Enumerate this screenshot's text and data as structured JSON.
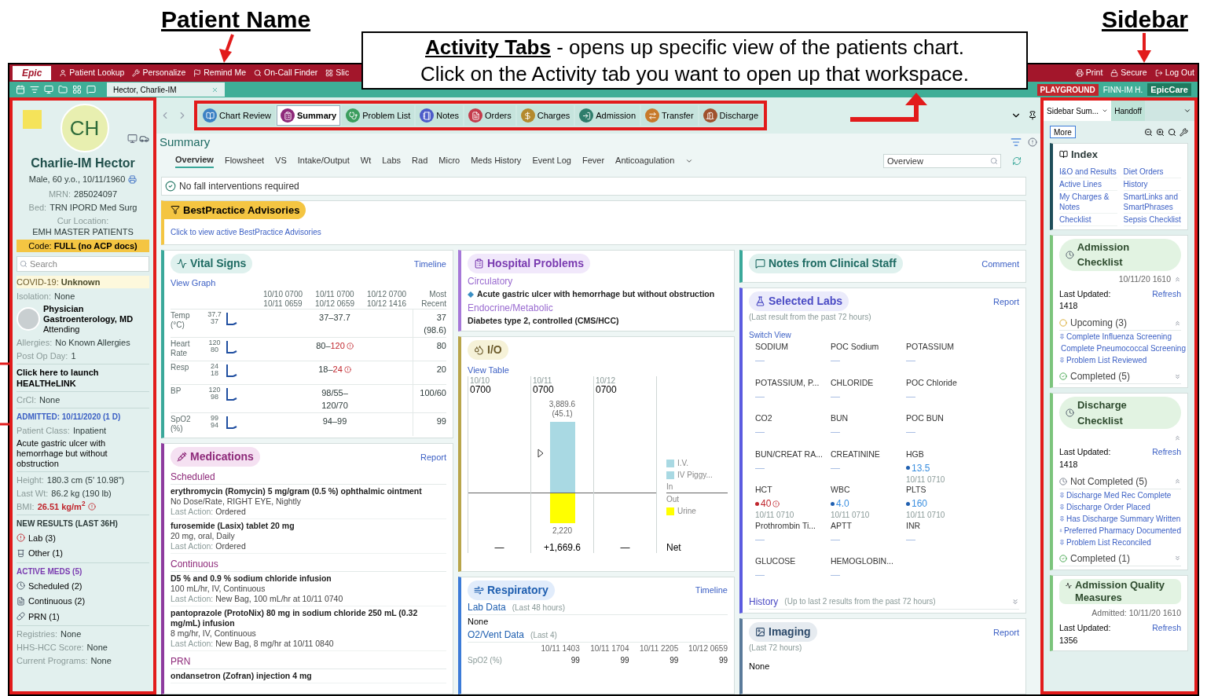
{
  "annotations": {
    "patient_name": "Patient Name",
    "sidebar": "Sidebar",
    "callout_title": "Activity Tabs",
    "callout_rest": " - opens up specific view of the patients chart.",
    "callout_line2": "Click on the Activity tab you want to open up that workspace."
  },
  "top_menu": {
    "logo": "Epic",
    "items": [
      "Patient Lookup",
      "Personalize",
      "Remind Me",
      "On-Call Finder",
      "Slic"
    ],
    "right_items": [
      "Print",
      "Secure",
      "Log Out"
    ]
  },
  "workspace_tab": "Hector, Charlie-IM",
  "environment": {
    "badge": "PLAYGROUND",
    "user": "FINN-IM H.",
    "app": "EpicCare"
  },
  "activity_tabs": [
    {
      "label": "Chart Review",
      "selected": false
    },
    {
      "label": "Summary",
      "selected": true
    },
    {
      "label": "Problem List",
      "selected": false
    },
    {
      "label": "Notes",
      "selected": false
    },
    {
      "label": "Orders",
      "selected": false
    },
    {
      "label": "Charges",
      "selected": false
    },
    {
      "label": "Admission",
      "selected": false
    },
    {
      "label": "Transfer",
      "selected": false
    },
    {
      "label": "Discharge",
      "selected": false
    }
  ],
  "patient": {
    "initials": "CH",
    "name": "Charlie-IM Hector",
    "demographics": "Male, 60 y.o., 10/11/1960",
    "details": [
      {
        "label": "MRN:",
        "value": "285024097"
      },
      {
        "label": "Bed:",
        "value": "TRN IPORD Med Surg"
      },
      {
        "label": "Cur Location:",
        "value": "EMH MASTER PATIENTS"
      }
    ],
    "code_label": "Code:",
    "code_value": "FULL (no ACP docs)",
    "search_placeholder": "Search",
    "covid_label": "COVID-19:",
    "covid_value": "Unknown",
    "isolation": {
      "label": "Isolation:",
      "value": "None"
    },
    "physician": {
      "role": "Physician",
      "specialty": "Gastroenterology, MD",
      "relation": "Attending"
    },
    "after_physician": [
      {
        "label": "Allergies:",
        "value": "No Known Allergies"
      },
      {
        "label": "Post Op Day:",
        "value": "1"
      }
    ],
    "healthelink": "Click here to launch HEALTHeLINK",
    "crcl": {
      "label": "CrCl:",
      "value": "None"
    },
    "admitted": "ADMITTED: 10/11/2020 (1 D)",
    "patient_class": {
      "label": "Patient Class:",
      "value": "Inpatient"
    },
    "diagnosis": "Acute gastric ulcer with hemorrhage but without obstruction",
    "measures": [
      {
        "label": "Height:",
        "value": "180.3 cm (5' 10.98\")",
        "flagged": false
      },
      {
        "label": "Last Wt:",
        "value": "86.2 kg (190 lb)",
        "flagged": false
      },
      {
        "label": "BMI:",
        "value": "26.51 kg/m$^{2}$",
        "flagged": true
      }
    ],
    "new_results": {
      "heading": "NEW RESULTS (LAST 36H)",
      "items": [
        "Lab (3)",
        "Other (1)"
      ]
    },
    "active_meds": {
      "heading": "ACTIVE MEDS (5)",
      "items": [
        "Scheduled (2)",
        "Continuous (2)",
        "PRN (1)"
      ]
    },
    "footer": [
      {
        "label": "Registries:",
        "value": "None"
      },
      {
        "label": "HHS-HCC Score:",
        "value": "None"
      },
      {
        "label": "Current Programs:",
        "value": "None"
      }
    ]
  },
  "summary": {
    "title": "Summary",
    "subtabs": [
      {
        "label": "Overview",
        "selected": true
      },
      {
        "label": "Flowsheet",
        "selected": false
      },
      {
        "label": "VS",
        "selected": false
      },
      {
        "label": "Intake/Output",
        "selected": false
      },
      {
        "label": "Wt",
        "selected": false
      },
      {
        "label": "Labs",
        "selected": false
      },
      {
        "label": "Rad",
        "selected": false
      },
      {
        "label": "Micro",
        "selected": false
      },
      {
        "label": "Meds History",
        "selected": false
      },
      {
        "label": "Event Log",
        "selected": false
      },
      {
        "label": "Fever",
        "selected": false
      },
      {
        "label": "Anticoagulation",
        "selected": false
      }
    ],
    "search_value": "Overview",
    "banner": "No fall interventions required",
    "bpa": {
      "title": "BestPractice Advisories",
      "link": "Click to view active BestPractice Advisories"
    },
    "vitals": {
      "title": "Vital Signs",
      "action": "Timeline",
      "link": "View Graph",
      "columns": [
        {
          "line1": "10/10 0700",
          "line2": "10/11 0659"
        },
        {
          "line1": "10/11 0700",
          "line2": "10/12 0659"
        },
        {
          "line1": "10/12 0700",
          "line2": "10/12 1416"
        },
        {
          "line1": "Most",
          "line2": "Recent"
        }
      ],
      "rows": [
        {
          "name": "Temp (°C)",
          "high": "37.7",
          "low": "37",
          "range": "37–37.7",
          "recent": "37 (98.6)"
        },
        {
          "name": "Heart Rate",
          "high": "120",
          "low": "80",
          "range": "80–",
          "flagged": "120",
          "recent": "80"
        },
        {
          "name": "Resp",
          "high": "24",
          "low": "18",
          "range": "18–",
          "flagged": "24",
          "recent": "20"
        },
        {
          "name": "BP",
          "high": "120",
          "low": "98",
          "range": "98/55–120/70",
          "recent": "100/60"
        },
        {
          "name": "SpO2 (%)",
          "high": "99",
          "low": "94",
          "range": "94–99",
          "recent": "99"
        }
      ]
    },
    "medications": {
      "title": "Medications",
      "action": "Report",
      "groups": [
        {
          "heading": "Scheduled",
          "items": [
            {
              "name": "erythromycin (Romycin) 5 mg/gram (0.5 %) ophthalmic ointment",
              "sig": "No Dose/Rate, RIGHT EYE, Nightly",
              "action_label": "Last Action:",
              "action": "Ordered"
            },
            {
              "name": "furosemide (Lasix) tablet 20 mg",
              "sig": "20 mg, oral, Daily",
              "action_label": "Last Action:",
              "action": "Ordered"
            }
          ]
        },
        {
          "heading": "Continuous",
          "items": [
            {
              "name": "D5 % and 0.9 % sodium chloride infusion",
              "sig": "100 mL/hr, IV, Continuous",
              "action_label": "Last Action:",
              "action": "New Bag, 100 mL/hr at 10/11 0740"
            },
            {
              "name": "pantoprazole (ProtoNix) 80 mg in sodium chloride 250 mL (0.32 mg/mL) infusion",
              "sig": "8 mg/hr, IV, Continuous",
              "action_label": "Last Action:",
              "action": "New Bag, 8 mg/hr at 10/11 0840"
            }
          ]
        },
        {
          "heading": "PRN",
          "items": [
            {
              "name": "ondansetron (Zofran) injection 4 mg"
            }
          ]
        }
      ]
    },
    "problems": {
      "title": "Hospital Problems",
      "groups": [
        {
          "category": "Circulatory",
          "items": [
            {
              "text": "Acute gastric ulcer with hemorrhage but without obstruction",
              "principal": true
            }
          ]
        },
        {
          "category": "Endocrine/Metabolic",
          "items": [
            {
              "text": "Diabetes type 2, controlled (CMS/HCC)",
              "principal": false
            }
          ]
        }
      ]
    },
    "io": {
      "title": "I/O",
      "link": "View Table",
      "dates": [
        {
          "date": "10/10",
          "time": "0700"
        },
        {
          "date": "10/11",
          "time": "0700"
        },
        {
          "date": "10/12",
          "time": "0700"
        }
      ],
      "in_total": "3,889.6",
      "in_sub": "(45.1)",
      "out_total": "2,220",
      "nets": [
        "—",
        "+1,669.6",
        "—"
      ],
      "net_label": "Net",
      "in_items": [
        {
          "label": "I.V.",
          "color": "#a9d9e3"
        },
        {
          "label": "IV Piggy...",
          "color": "#a9d9e3"
        }
      ],
      "in_label": "In",
      "out_label": "Out",
      "out_items": [
        {
          "label": "Urine",
          "color": "#ffff00"
        }
      ]
    },
    "respiratory": {
      "title": "Respiratory",
      "action": "Timeline",
      "lab_title": "Lab Data",
      "lab_note": "(Last 48 hours)",
      "lab_value": "None",
      "vent_title": "O2/Vent Data",
      "vent_note": "(Last 4)",
      "times": [
        "10/11 1403",
        "10/11 1704",
        "10/11 2205",
        "10/12 0659"
      ],
      "row_label": "SpO2 (%)",
      "values": [
        "99",
        "99",
        "99",
        "99"
      ]
    },
    "notes": {
      "title": "Notes from Clinical Staff",
      "action": "Comment"
    },
    "labs": {
      "title": "Selected Labs",
      "action": "Report",
      "subtitle": "(Last result from the past 72 hours)",
      "link": "Switch View",
      "items": [
        {
          "name": "SODIUM",
          "value": "—",
          "abnormal": false
        },
        {
          "name": "POC Sodium",
          "value": "—",
          "abnormal": false
        },
        {
          "name": "POTASSIUM",
          "value": "—",
          "abnormal": false
        },
        {
          "name": "POTASSIUM, P...",
          "value": "—",
          "abnormal": false
        },
        {
          "name": "CHLORIDE",
          "value": "—",
          "abnormal": false
        },
        {
          "name": "POC Chloride",
          "value": "—",
          "abnormal": false
        },
        {
          "name": "CO2",
          "value": "—",
          "abnormal": false
        },
        {
          "name": "BUN",
          "value": "—",
          "abnormal": false
        },
        {
          "name": "POC BUN",
          "value": "—",
          "abnormal": false
        },
        {
          "name": "BUN/CREAT RA...",
          "value": "—",
          "abnormal": false
        },
        {
          "name": "CREATININE",
          "value": "—",
          "abnormal": false
        },
        {
          "name": "HGB",
          "value": "13.5",
          "time": "10/11 0710",
          "abnormal": false
        },
        {
          "name": "HCT",
          "value": "40",
          "time": "10/11 0710",
          "abnormal": true
        },
        {
          "name": "WBC",
          "value": "4.0",
          "time": "10/11 0710",
          "abnormal": false
        },
        {
          "name": "PLTS",
          "value": "160",
          "time": "10/11 0710",
          "abnormal": false
        },
        {
          "name": "Prothrombin Ti...",
          "value": "—",
          "abnormal": false
        },
        {
          "name": "APTT",
          "value": "—",
          "abnormal": false
        },
        {
          "name": "INR",
          "value": "—",
          "abnormal": false
        },
        {
          "name": "GLUCOSE",
          "value": "—",
          "abnormal": false
        },
        {
          "name": "HEMOGLOBIN...",
          "value": "—",
          "abnormal": false
        }
      ],
      "history_title": "History",
      "history_note": "(Up to last 2 results from the past 72 hours)"
    },
    "imaging": {
      "title": "Imaging",
      "action": "Report",
      "subtitle": "(Last 72 hours)",
      "value": "None"
    }
  },
  "right_sidebar": {
    "tabs": [
      {
        "label": "Sidebar Sum...",
        "selected": true
      },
      {
        "label": "Handoff",
        "selected": false
      }
    ],
    "more": "More",
    "index": {
      "title": "Index",
      "links": [
        "I&O and Results",
        "Diet Orders",
        "Active Lines",
        "History",
        "My Charges & Notes",
        "SmartLinks and SmartPhrases",
        "Checklist",
        "Sepsis Checklist"
      ]
    },
    "admission": {
      "title": "Admission Checklist",
      "date": "10/11/20 1610",
      "updated_label": "Last Updated:",
      "updated": "1418",
      "refresh": "Refresh",
      "open_heading": "Upcoming (3)",
      "open_items": [
        "Complete Influenza Screening",
        "Complete Pneumococcal Screening",
        "Problem List Reviewed"
      ],
      "done_heading": "Completed (5)"
    },
    "discharge": {
      "title": "Discharge Checklist",
      "updated_label": "Last Updated:",
      "updated": "1418",
      "refresh": "Refresh",
      "open_heading": "Not Completed (5)",
      "open_items": [
        "Discharge Med Rec Complete",
        "Discharge Order Placed",
        "Has Discharge Summary Written",
        "Preferred Pharmacy Documented",
        "Problem List Reconciled"
      ],
      "done_heading": "Completed (1)"
    },
    "quality": {
      "title": "Admission Quality Measures",
      "admitted": "Admitted: 10/11/20 1610",
      "updated_label": "Last Updated:",
      "updated": "1356",
      "refresh": "Refresh"
    }
  }
}
